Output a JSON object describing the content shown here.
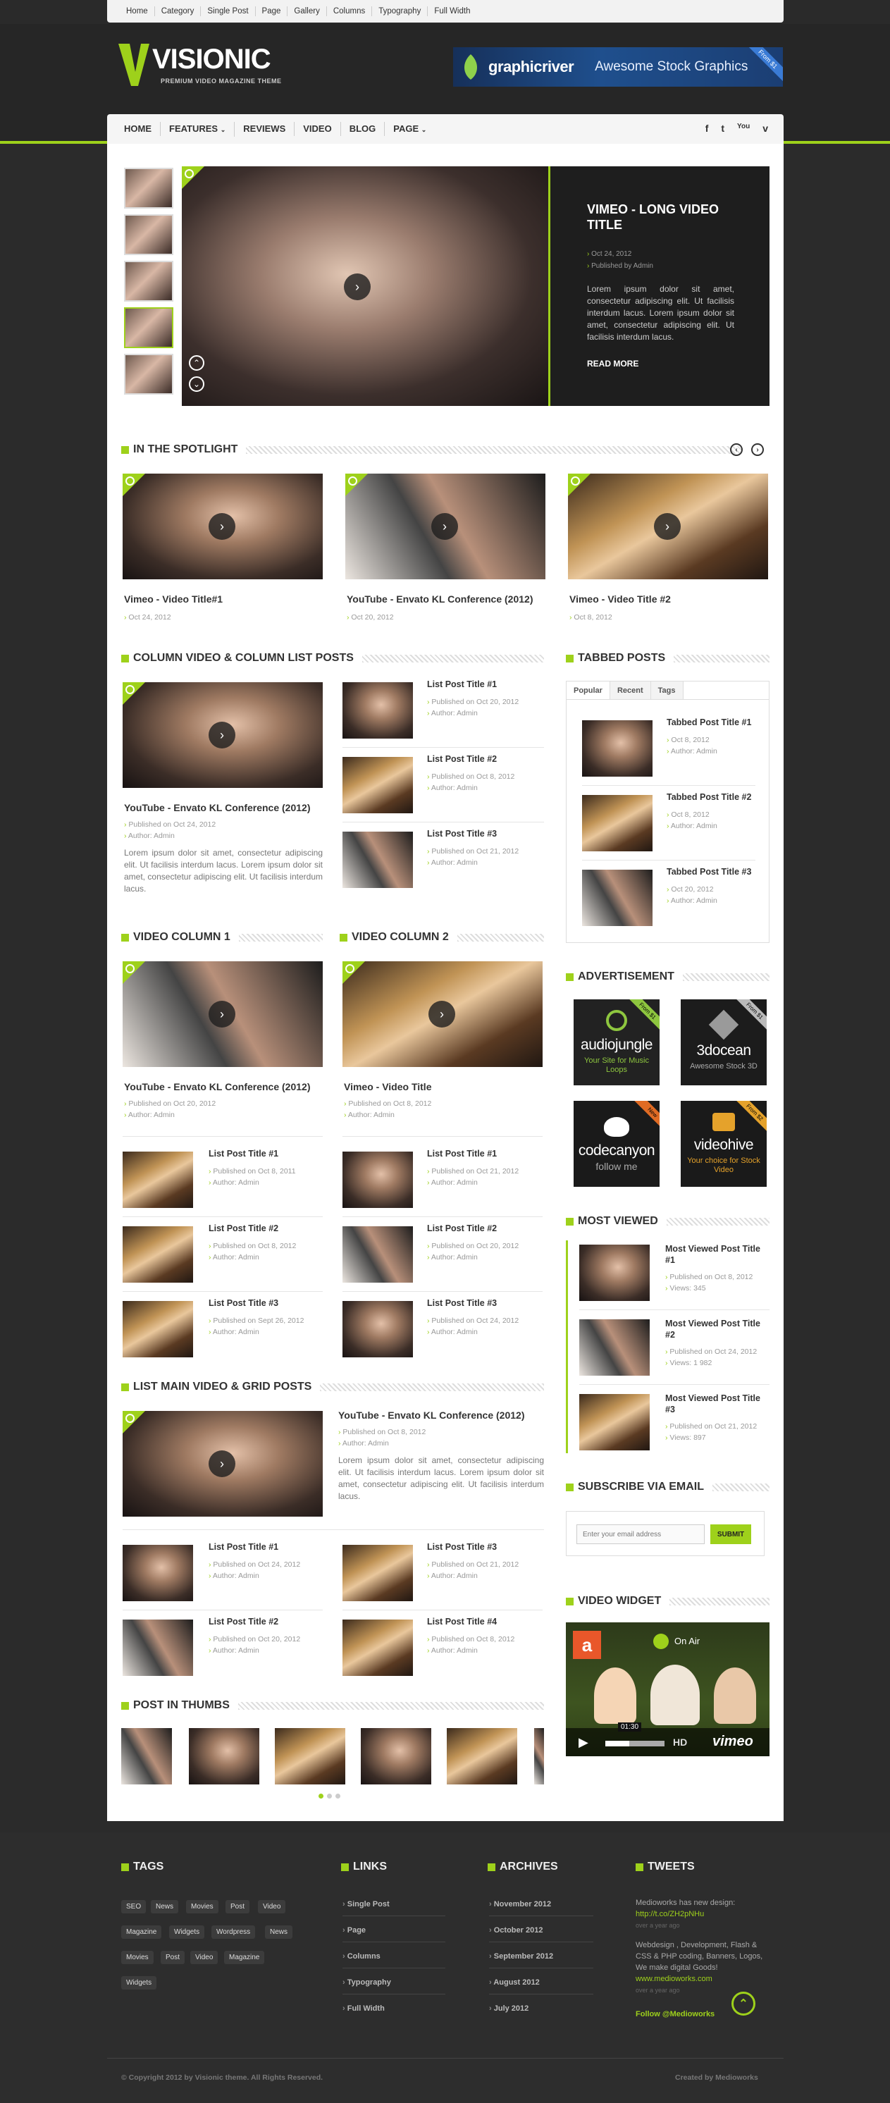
{
  "topmenu": [
    "Home",
    "Category",
    "Single Post",
    "Page",
    "Gallery",
    "Columns",
    "Typography",
    "Full Width"
  ],
  "logo": {
    "name": "VISIONIC",
    "tagline": "PREMIUM VIDEO MAGAZINE THEME"
  },
  "banner": {
    "brand": "graphicriver",
    "text": "Awesome Stock Graphics",
    "corner": "From $1"
  },
  "nav": [
    "HOME",
    "FEATURES",
    "REVIEWS",
    "VIDEO",
    "BLOG",
    "PAGE"
  ],
  "social": [
    "f",
    "t",
    "You",
    "v"
  ],
  "slider": {
    "title": "VIMEO - LONG VIDEO TITLE",
    "date": "Oct 24, 2012",
    "author": "Published by Admin",
    "excerpt": "Lorem ipsum dolor sit amet, consectetur adipiscing elit. Ut facilisis interdum lacus. Lorem ipsum dolor sit amet, consectetur adipiscing elit. Ut facilisis interdum lacus.",
    "more": "READ MORE"
  },
  "spotlight": {
    "heading": "IN THE SPOTLIGHT",
    "items": [
      {
        "title": "Vimeo - Video Title#1",
        "date": "Oct 24, 2012"
      },
      {
        "title": "YouTube - Envato KL Conference (2012)",
        "date": "Oct 20, 2012"
      },
      {
        "title": "Vimeo - Video Title #2",
        "date": "Oct 8, 2012"
      }
    ]
  },
  "colvideo": {
    "heading": "COLUMN VIDEO & COLUMN LIST POSTS",
    "main": {
      "title": "YouTube - Envato KL Conference (2012)",
      "date": "Published on Oct 24, 2012",
      "author": "Author: Admin",
      "excerpt": "Lorem ipsum dolor sit amet, consectetur adipiscing elit. Ut facilisis interdum lacus. Lorem ipsum dolor sit amet, consectetur adipiscing elit. Ut facilisis interdum lacus."
    },
    "list": [
      {
        "title": "List Post Title #1",
        "date": "Published on Oct 20, 2012",
        "author": "Author: Admin"
      },
      {
        "title": "List Post Title #2",
        "date": "Published on Oct 8, 2012",
        "author": "Author: Admin"
      },
      {
        "title": "List Post Title #3",
        "date": "Published on Oct 21, 2012",
        "author": "Author: Admin"
      }
    ]
  },
  "tabbed": {
    "heading": "TABBED POSTS",
    "tabs": [
      "Popular",
      "Recent",
      "Tags"
    ],
    "items": [
      {
        "title": "Tabbed Post Title #1",
        "date": "Oct 8, 2012",
        "author": "Author: Admin"
      },
      {
        "title": "Tabbed Post Title #2",
        "date": "Oct 8, 2012",
        "author": "Author: Admin"
      },
      {
        "title": "Tabbed Post Title #3",
        "date": "Oct 20, 2012",
        "author": "Author: Admin"
      }
    ]
  },
  "vcol1": {
    "heading": "VIDEO COLUMN 1",
    "main": {
      "title": "YouTube - Envato KL Conference (2012)",
      "date": "Published on Oct 20, 2012",
      "author": "Author: Admin"
    },
    "list": [
      {
        "title": "List Post Title #1",
        "date": "Published on Oct 8, 2011",
        "author": "Author: Admin"
      },
      {
        "title": "List Post Title #2",
        "date": "Published on Oct 8, 2012",
        "author": "Author: Admin"
      },
      {
        "title": "List Post Title #3",
        "date": "Published on Sept 26, 2012",
        "author": "Author: Admin"
      }
    ]
  },
  "vcol2": {
    "heading": "VIDEO COLUMN 2",
    "main": {
      "title": "Vimeo - Video Title",
      "date": "Published on Oct 8, 2012",
      "author": "Author: Admin"
    },
    "list": [
      {
        "title": "List Post Title #1",
        "date": "Published on Oct 21, 2012",
        "author": "Author: Admin"
      },
      {
        "title": "List Post Title #2",
        "date": "Published on Oct 20, 2012",
        "author": "Author: Admin"
      },
      {
        "title": "List Post Title #3",
        "date": "Published on Oct 24, 2012",
        "author": "Author: Admin"
      }
    ]
  },
  "ads": {
    "heading": "ADVERTISEMENT",
    "items": [
      {
        "name": "audiojungle",
        "sub": "Your Site for Music Loops",
        "rib": "From $1"
      },
      {
        "name": "3docean",
        "sub": "Awesome Stock 3D",
        "rib": "From $1"
      },
      {
        "name": "codecanyon",
        "sub": "follow me",
        "rib": "New"
      },
      {
        "name": "videohive",
        "sub": "Your choice for Stock Video",
        "rib": "From $2"
      }
    ]
  },
  "mostviewed": {
    "heading": "MOST VIEWED",
    "items": [
      {
        "title": "Most Viewed Post Title #1",
        "date": "Published on Oct 8, 2012",
        "views": "Views: 345"
      },
      {
        "title": "Most Viewed Post Title #2",
        "date": "Published on Oct 24, 2012",
        "views": "Views: 1 982"
      },
      {
        "title": "Most Viewed Post Title #3",
        "date": "Published on Oct 21, 2012",
        "views": "Views: 897"
      }
    ]
  },
  "listgrid": {
    "heading": "LIST MAIN VIDEO & GRID POSTS",
    "main": {
      "title": "YouTube - Envato KL Conference (2012)",
      "date": "Published on Oct 8, 2012",
      "author": "Author: Admin",
      "excerpt": "Lorem ipsum dolor sit amet, consectetur adipiscing elit. Ut facilisis interdum lacus. Lorem ipsum dolor sit amet, consectetur adipiscing elit. Ut facilisis interdum lacus."
    },
    "grid": [
      {
        "title": "List Post Title #1",
        "date": "Published on Oct 24, 2012",
        "author": "Author: Admin"
      },
      {
        "title": "List Post Title #3",
        "date": "Published on Oct 21, 2012",
        "author": "Author: Admin"
      },
      {
        "title": "List Post Title #2",
        "date": "Published on Oct 20, 2012",
        "author": "Author: Admin"
      },
      {
        "title": "List Post Title #4",
        "date": "Published on Oct 8, 2012",
        "author": "Author: Admin"
      }
    ]
  },
  "subscribe": {
    "heading": "SUBSCRIBE VIA EMAIL",
    "placeholder": "Enter your email address",
    "button": "SUBMIT"
  },
  "videowidget": {
    "heading": "VIDEO WIDGET",
    "onair": "On Air",
    "time": "01:30",
    "brand": "vimeo",
    "hd": "HD"
  },
  "thumbs": {
    "heading": "POST IN THUMBS"
  },
  "footer": {
    "tags_heading": "TAGS",
    "tags": [
      "SEO",
      "News",
      "Movies",
      "Post",
      "Video",
      "Magazine",
      "Widgets",
      "Wordpress",
      "News",
      "Movies",
      "Post",
      "Video",
      "Magazine",
      "Widgets"
    ],
    "links_heading": "LINKS",
    "links": [
      "Single Post",
      "Page",
      "Columns",
      "Typography",
      "Full Width"
    ],
    "archives_heading": "ARCHIVES",
    "archives": [
      "November 2012",
      "October 2012",
      "September 2012",
      "August 2012",
      "July 2012"
    ],
    "tweets_heading": "TWEETS",
    "tweet1": "Medioworks has new design:",
    "tweet1_link": "http://t.co/ZH2pNHu",
    "tweet_ago": "over a year ago",
    "tweet2": "Webdesign , Development, Flash & CSS & PHP coding, Banners, Logos, We make digital Goods!",
    "tweet2_link": "www.medioworks.com",
    "follow": "Follow @Medioworks",
    "copyright": "© Copyright 2012 by Visionic theme. All Rights Reserved.",
    "credit": "Created by Medioworks"
  }
}
